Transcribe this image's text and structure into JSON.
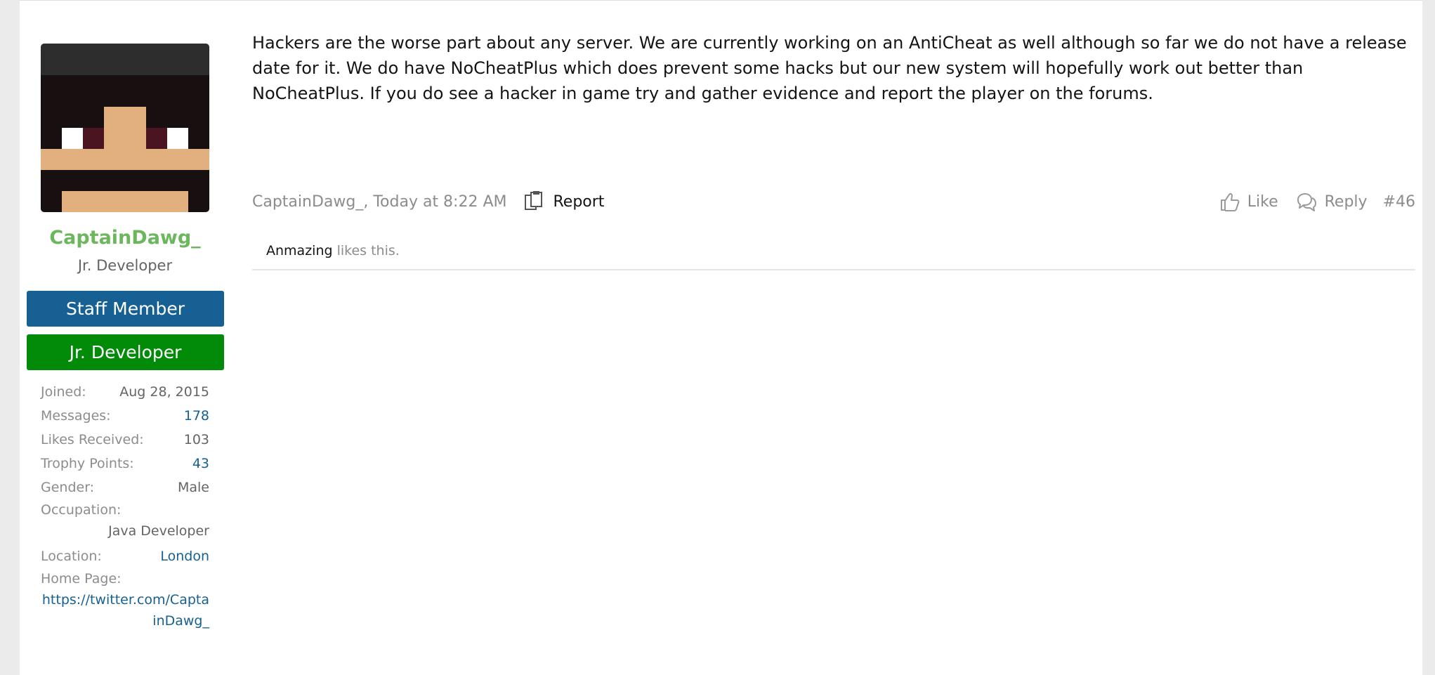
{
  "user": {
    "username": "CaptainDawg_",
    "title": "Jr. Developer",
    "banners": [
      "Staff Member",
      "Jr. Developer"
    ],
    "stats": {
      "joined_label": "Joined:",
      "joined": "Aug 28, 2015",
      "messages_label": "Messages:",
      "messages": "178",
      "likes_label": "Likes Received:",
      "likes": "103",
      "trophy_label": "Trophy Points:",
      "trophy": "43",
      "gender_label": "Gender:",
      "gender": "Male",
      "occupation_label": "Occupation:",
      "occupation": "Java Developer",
      "location_label": "Location:",
      "location": "London",
      "homepage_label": "Home Page:",
      "homepage": "https://twitter.com/CaptainDawg_"
    }
  },
  "post": {
    "body": "Hackers are the worse part about any server. We are currently working on an AntiCheat as well although so far we do not have a release date for it. We do have NoCheatPlus which does prevent some hacks but our new system will hopefully work out better than NoCheatPlus. If you do see a hacker in game try and gather evidence and report the player on the forums.",
    "author_date": "CaptainDawg_, Today at 8:22 AM",
    "report_label": "Report",
    "like_label": "Like",
    "reply_label": "Reply",
    "post_number": "#46",
    "liker": "Anmazing",
    "likes_suffix": " likes this."
  },
  "colors": {
    "username": "#6cb75d",
    "staff_banner": "#176093",
    "dev_banner": "#028a09",
    "link": "#176093"
  },
  "icons": [
    "avatar",
    "report-icon",
    "like-icon",
    "reply-icon"
  ]
}
